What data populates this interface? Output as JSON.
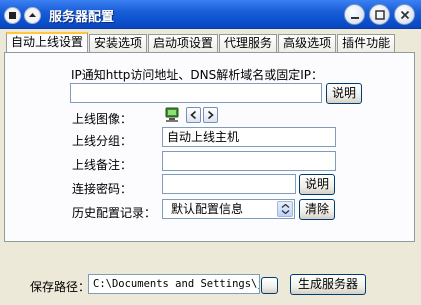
{
  "window": {
    "title": "服务器配置"
  },
  "tabs": [
    {
      "label": "自动上线设置"
    },
    {
      "label": "安装选项"
    },
    {
      "label": "启动项设置"
    },
    {
      "label": "代理服务"
    },
    {
      "label": "高级选项"
    },
    {
      "label": "插件功能"
    }
  ],
  "form": {
    "dns_label": "IP通知http访问地址、DNS解析域名或固定IP：",
    "dns_value": "",
    "dns_help_button": "说明",
    "image_label": "上线图像：",
    "group_label": "上线分组：",
    "group_value": "自动上线主机",
    "remark_label": "上线备注：",
    "remark_value": "",
    "password_label": "连接密码：",
    "password_value": "",
    "password_help_button": "说明",
    "history_label": "历史配置记录：",
    "history_selected": "默认配置信息",
    "clear_button": "清除"
  },
  "bottom": {
    "save_path_label": "保存路径：",
    "save_path_value": "C:\\Documents and Settings\\ji",
    "generate_button": "生成服务器"
  }
}
